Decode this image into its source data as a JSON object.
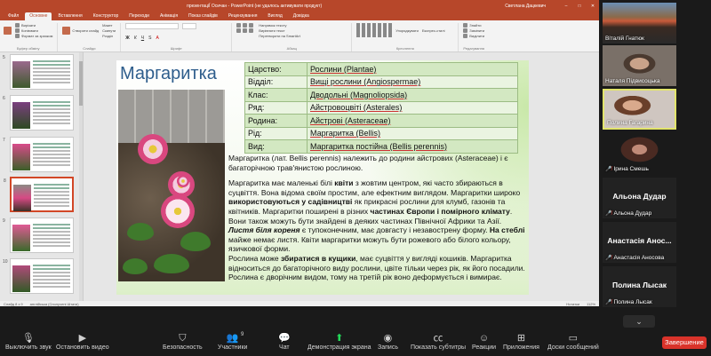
{
  "ppt": {
    "title": "презентаціЇ Осичан - PowerPoint (не удалось активувати продукт)",
    "user": "Светлана Дацкевич",
    "tabs": [
      "Файл",
      "Основне",
      "Вставлення",
      "Конструктор",
      "Переходи",
      "Анімація",
      "Показ слайдів",
      "Рецензування",
      "Вигляд",
      "Довідка"
    ],
    "ribbon": {
      "clipboard": [
        "Вирізати",
        "Копіювати",
        "Формат за зразком"
      ],
      "clipboard_label": "Буфер обміну",
      "slides": [
        "Створити слайд",
        "Макет",
        "Скинути",
        "Розділ"
      ],
      "slides_label": "Слайди",
      "font_label": "Шрифт",
      "paragraph_label": "Абзац",
      "paragraph": [
        "Напрямок тексту",
        "Вирівняти текст",
        "Перетворити на SmartArt"
      ],
      "drawing_label": "Креслення",
      "drawing": [
        "Упорядкувати",
        "Експрес-стилі"
      ],
      "editing_label": "Редагування",
      "editing": [
        "Знайти",
        "Замінити",
        "Виділити"
      ]
    },
    "slide": {
      "title": "Маргаритка",
      "table": [
        {
          "k": "Царство:",
          "v": "Рослини (Plantae)"
        },
        {
          "k": "Відділ:",
          "v": "Вищі рослини (Angiospermae)"
        },
        {
          "k": "Клас:",
          "v": "Дводольні (Magnoliopsida)"
        },
        {
          "k": "Ряд:",
          "v": "Айстровоцвіті (Asterales)"
        },
        {
          "k": "Родина:",
          "v": "Айстрові (Asteraceae)"
        },
        {
          "k": "Рід:",
          "v": "Маргаритка (Bellis)"
        },
        {
          "k": "Вид:",
          "v": "Маргаритка постійна (Bellis perennis)"
        }
      ],
      "p1": "Маргаритка (лат. Bellis perennis) належить до родини айстрових (Asteraceae) і є багаторічною трав'янистою рослиною.",
      "p2a": "Маргаритка має маленькі білі ",
      "p2b": "квіти",
      "p2c": " з жовтим центром, які часто збираються в суцвіття. Вона відома своїм простим, але ефектним виглядом. Маргаритки широко ",
      "p2d": "використовуються у садівництві",
      "p2e": " як прикрасні рослини для клумб, газонів та квітників. Маргаритки поширені в різних ",
      "p2f": "частинах Європи і помірного клімату",
      "p2g": ". Вони також можуть бути знайдені в деяких частинах Північної Африки та Азії.",
      "p3a": "Листя біля кореня",
      "p3b": " є тупоконечним, має довгасту і незавострену форму. ",
      "p3c": "На стеблі",
      "p3d": " майже немає листя. Квіти маргаритки можуть бути рожевого або білого кольору, язичкової форми.",
      "p4a": "Рослина може ",
      "p4b": "збиратися в кущики",
      "p4c": ", має суцвіття у вигляді кошиків. Маргаритка відноситься до багаторічного виду рослини, цвіте тільки через рік, як його посадили. Рослина є дворічним видом, тому на третій рік воно деформується і вимирає."
    },
    "thumb_numbers": [
      "5",
      "6",
      "7",
      "8",
      "9",
      "10"
    ],
    "status": {
      "slide": "Слайд 8 з 9",
      "lang": "англійська (Сполучені Штати)",
      "notes": "Нотатки",
      "zoom": "112%"
    }
  },
  "participants": [
    {
      "name": "Віталій Гнатюк",
      "mic_off": false,
      "has_video": true
    },
    {
      "name": "Наталя Підвисоцька",
      "mic_off": false,
      "has_video": true
    },
    {
      "name": "Полина Гагарина",
      "mic_off": false,
      "has_video": true
    },
    {
      "name": "Ірина Смешь",
      "mic_off": true,
      "has_video": true
    },
    {
      "name": "Альона Дудар",
      "display": "Альона Дудар",
      "mic_off": true,
      "has_video": false
    },
    {
      "name": "Анастасія Аносова",
      "display": "Анастасія  Анос...",
      "mic_off": true,
      "has_video": false
    },
    {
      "name": "Полина Лысак",
      "display": "Полина Лысак",
      "mic_off": true,
      "has_video": false
    }
  ],
  "toolbar": {
    "mute": "Выключить звук",
    "video": "Остановить видео",
    "security": "Безопасность",
    "participants": "Участники",
    "participants_count": "9",
    "chat": "Чат",
    "share": "Демонстрация экрана",
    "record": "Запись",
    "captions": "Показать субтитры",
    "reactions": "Реакции",
    "apps": "Приложения",
    "whiteboards": "Доски сообщений",
    "end": "Завершение"
  },
  "colors": {
    "ppt_accent": "#b7472a",
    "zoom_end": "#d9332a",
    "share_green": "#23d959",
    "active_speaker": "#e2e46b",
    "slide_title": "#2e5d8c"
  }
}
